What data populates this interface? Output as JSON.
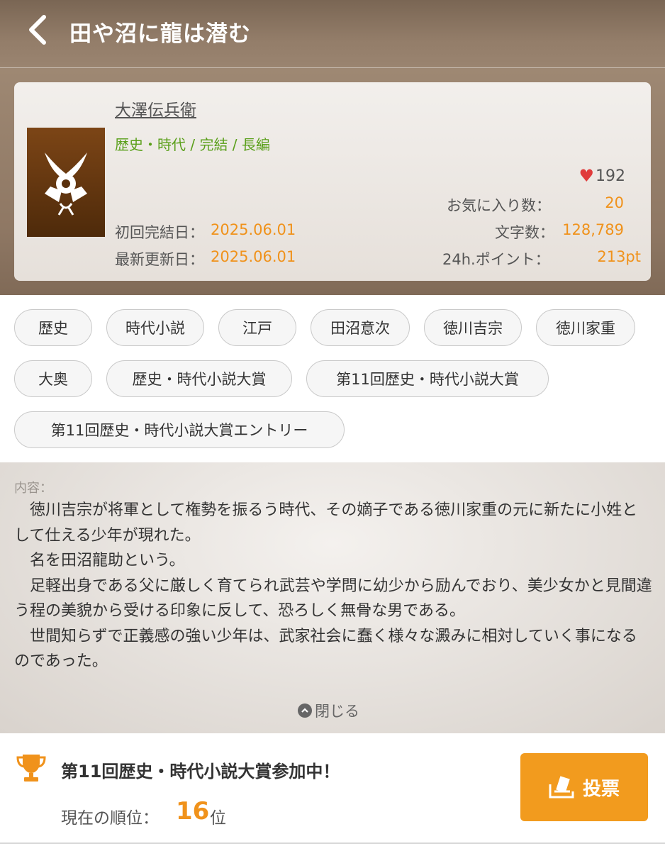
{
  "header": {
    "title": "田や沼に龍は潜む"
  },
  "work": {
    "author": "大澤伝兵衛",
    "genre": "歴史・時代 / 完結 / 長編",
    "likes": "192",
    "favorites_label": "お気に入り数：",
    "favorites_value": "20",
    "first_completed_label": "初回完結日：",
    "first_completed_value": "2025.06.01",
    "characters_label": "文字数：",
    "characters_value": "128,789",
    "last_updated_label": "最新更新日：",
    "last_updated_value": "2025.06.01",
    "points_label": "24h.ポイント：",
    "points_value": "213pt"
  },
  "tags": [
    "歴史",
    "時代小説",
    "江戸",
    "田沼意次",
    "徳川吉宗",
    "徳川家重",
    "大奥",
    "歴史・時代小説大賞",
    "第11回歴史・時代小説大賞",
    "第11回歴史・時代小説大賞エントリー"
  ],
  "description": {
    "label": "内容：",
    "paragraphs": [
      "徳川吉宗が将軍として権勢を振るう時代、その嫡子である徳川家重の元に新たに小姓として仕える少年が現れた。",
      "名を田沼龍助という。",
      "足軽出身である父に厳しく育てられ武芸や学問に幼少から励んでおり、美少女かと見間違う程の美貌から受ける印象に反して、恐ろしく無骨な男である。",
      "世間知らずで正義感の強い少年は、武家社会に蠢く様々な澱みに相対していく事になるのであった。"
    ],
    "close_label": "閉じる"
  },
  "contest": {
    "title": "第11回歴史・時代小説大賞参加中！",
    "rank_label": "現在の順位：",
    "rank_value": "16",
    "rank_unit": "位",
    "vote_label": "投票"
  },
  "icons": {
    "back": "back-chevron-icon",
    "heart": "heart-icon",
    "trophy": "trophy-icon",
    "vote": "vote-box-icon",
    "close": "chevron-up-icon"
  },
  "colors": {
    "accent": "#f0921b",
    "genre": "#5a9f1a",
    "heart": "#e03b3b"
  }
}
